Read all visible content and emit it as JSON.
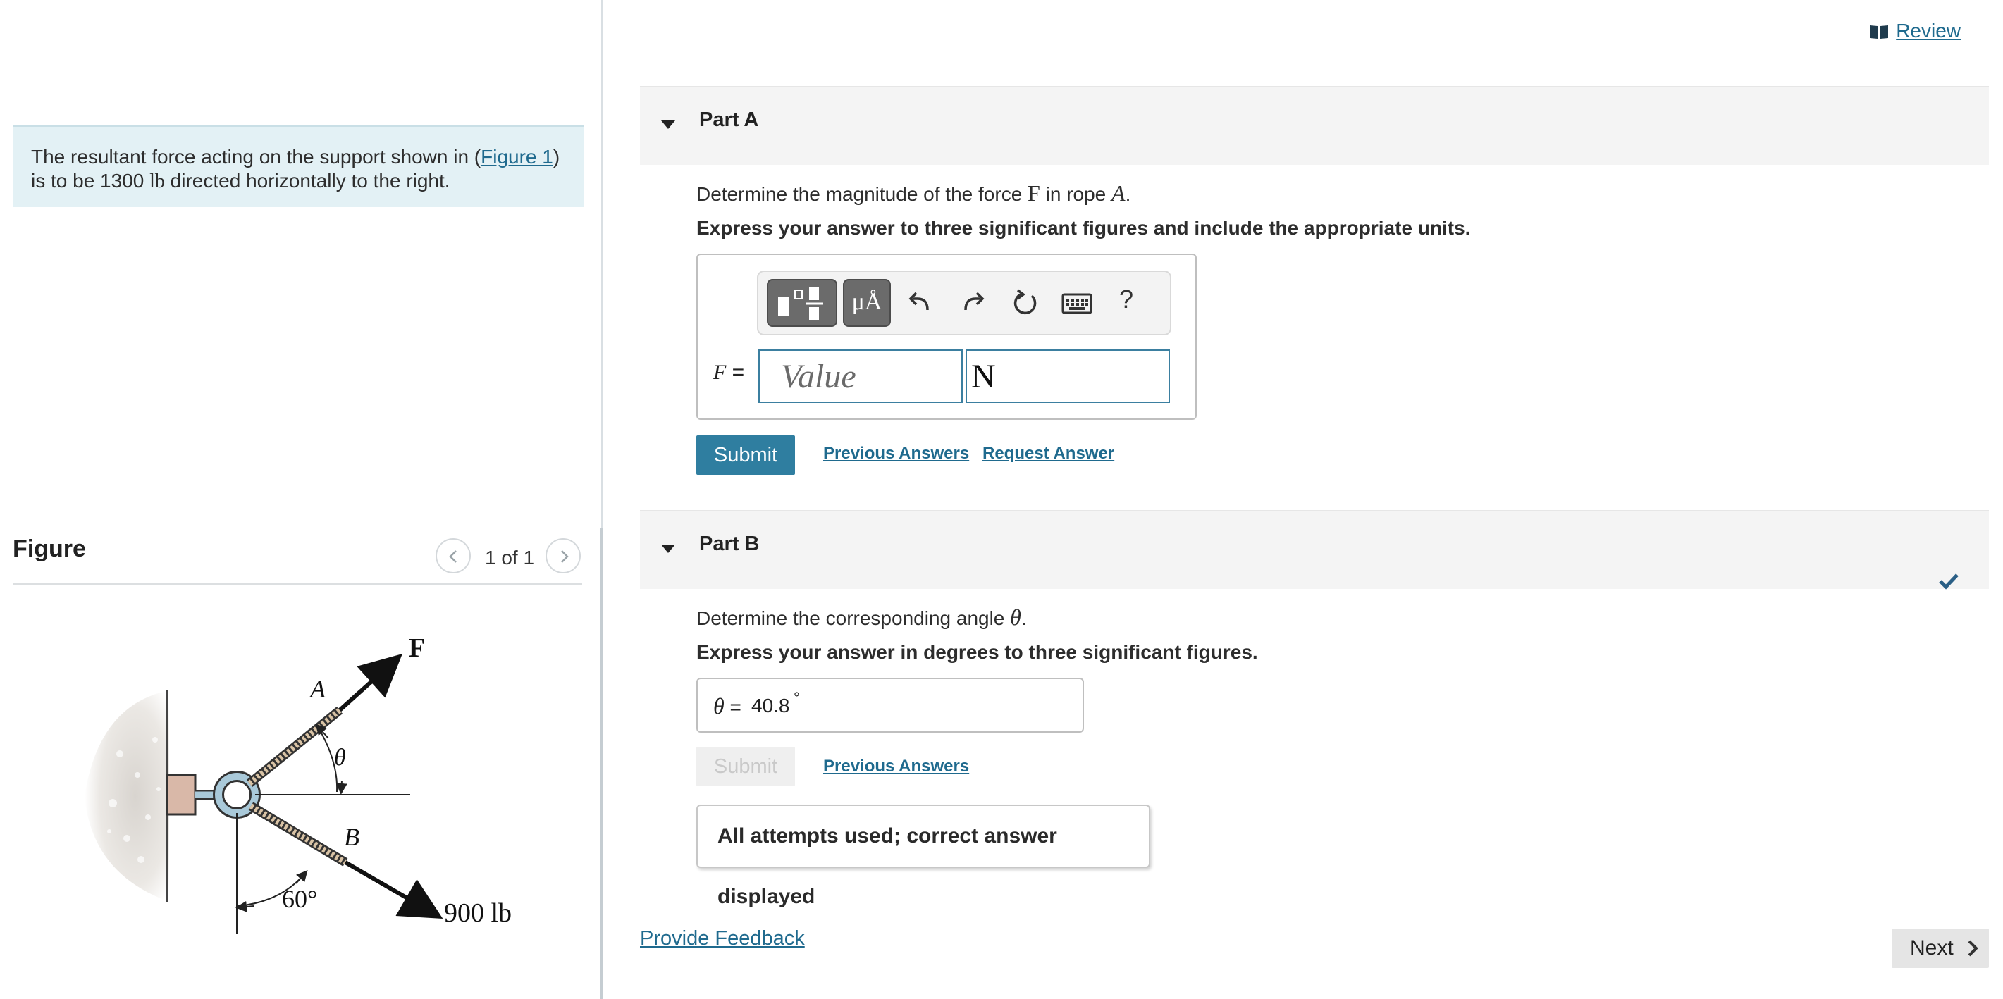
{
  "header": {
    "review_label": "Review",
    "review_icon": "book-icon"
  },
  "problem": {
    "text_before_link": "The resultant force acting on the support shown in (",
    "figure_link": "Figure 1",
    "text_mid": ") is to be 1300 ",
    "unit": "lb",
    "text_after": " directed horizontally to the right."
  },
  "figure_panel": {
    "heading": "Figure",
    "pager": "1 of 1",
    "labels": {
      "force": "F",
      "rope_a": "A",
      "rope_b": "B",
      "theta": "θ",
      "angle": "60°",
      "force_b": "900 lb"
    }
  },
  "partA": {
    "title": "Part A",
    "prompt_before": "Determine the magnitude of the force ",
    "prompt_force": "F",
    "prompt_mid": " in rope ",
    "prompt_rope": "A",
    "prompt_end": ".",
    "instruction": "Express your answer to three significant figures and include the appropriate units.",
    "toolbar": {
      "templates_icon": "templates-icon",
      "symbols_label": "μÅ",
      "undo_icon": "undo-icon",
      "redo_icon": "redo-icon",
      "reset_icon": "reset-icon",
      "keyboard_icon": "keyboard-icon",
      "help_label": "?"
    },
    "variable_label": "F",
    "equals": "=",
    "value_placeholder": "Value",
    "units_value": "N",
    "submit_label": "Submit",
    "previous_answers_label": "Previous Answers",
    "request_answer_label": "Request Answer"
  },
  "partB": {
    "title": "Part B",
    "prompt_before": "Determine the corresponding angle ",
    "prompt_symbol": "θ",
    "prompt_end": ".",
    "instruction": "Express your answer in degrees to three significant figures.",
    "variable_label": "θ",
    "equals": "=",
    "answer_value": "40.8",
    "answer_unit": "°",
    "submit_label": "Submit",
    "previous_answers_label": "Previous Answers",
    "status_message": "All attempts used; correct answer displayed",
    "status_icon": "checkmark-icon"
  },
  "footer": {
    "feedback_label": "Provide Feedback",
    "next_label": "Next"
  },
  "colors": {
    "link": "#1f6a8e",
    "submit_active": "#2f7ea0",
    "problem_bg": "#e3f1f5",
    "input_border": "#3b7fa0"
  }
}
